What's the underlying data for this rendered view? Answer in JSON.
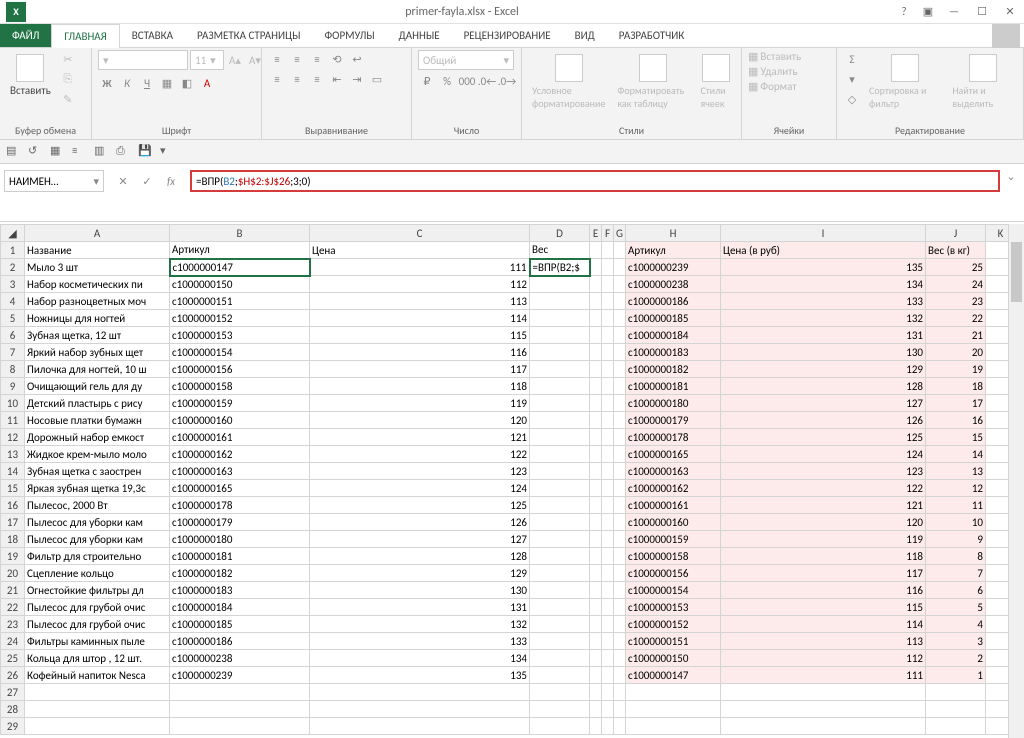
{
  "title": "primer-fayla.xlsx - Excel",
  "tabs": {
    "file": "ФАЙЛ",
    "items": [
      "ГЛАВНАЯ",
      "ВСТАВКА",
      "РАЗМЕТКА СТРАНИЦЫ",
      "ФОРМУЛЫ",
      "ДАННЫЕ",
      "РЕЦЕНЗИРОВАНИЕ",
      "ВИД",
      "РАЗРАБОТЧИК"
    ],
    "active": 0
  },
  "ribbon": {
    "paste": "Вставить",
    "clipboard": "Буфер обмена",
    "font_group": "Шрифт",
    "font_size": "11",
    "align": "Выравнивание",
    "number": "Число",
    "number_format": "Общий",
    "styles": "Стили",
    "cond_fmt": "Условное форматирование",
    "fmt_table": "Форматировать как таблицу",
    "cell_styles": "Стили ячеек",
    "cells": "Ячейки",
    "insert": "Вставить",
    "delete": "Удалить",
    "format": "Формат",
    "editing": "Редактирование",
    "sort": "Сортировка и фильтр",
    "find": "Найти и выделить"
  },
  "namebox": "НАИМЕН…",
  "formula": {
    "raw": "=ВПР(B2;$H$2:$J$26;3;0)",
    "prefix": "=ВПР(",
    "arg1": "B2",
    "sep1": ";",
    "arg2": "$H$2:$J$26",
    "sep2": ";",
    "arg3": "3",
    "sep3": ";",
    "arg4": "0",
    "suffix": ")"
  },
  "columns": [
    "A",
    "B",
    "C",
    "D",
    "E",
    "F",
    "G",
    "H",
    "I",
    "J",
    "K"
  ],
  "headers_left": {
    "A": "Название",
    "B": "Артикул",
    "C": "Цена",
    "D": "Вес"
  },
  "headers_right": {
    "H": "Артикул",
    "I": "Цена (в руб)",
    "J": "Вес (в кг)"
  },
  "d2_display": "=ВПР(B2;$",
  "rows_left": [
    {
      "n": 2,
      "a": "Мыло 3 шт",
      "b": "c1000000147",
      "c": 111
    },
    {
      "n": 3,
      "a": "Набор косметических пи",
      "b": "c1000000150",
      "c": 112
    },
    {
      "n": 4,
      "a": "Набор разноцветных моч",
      "b": "c1000000151",
      "c": 113
    },
    {
      "n": 5,
      "a": "Ножницы для ногтей",
      "b": "c1000000152",
      "c": 114
    },
    {
      "n": 6,
      "a": "Зубная щетка, 12 шт",
      "b": "c1000000153",
      "c": 115
    },
    {
      "n": 7,
      "a": "Яркий набор зубных щет",
      "b": "c1000000154",
      "c": 116
    },
    {
      "n": 8,
      "a": "Пилочка для ногтей, 10 ш",
      "b": "c1000000156",
      "c": 117
    },
    {
      "n": 9,
      "a": "Очищающий гель для ду",
      "b": "c1000000158",
      "c": 118
    },
    {
      "n": 10,
      "a": "Детский пластырь с рису",
      "b": "c1000000159",
      "c": 119
    },
    {
      "n": 11,
      "a": "Носовые платки бумажн",
      "b": "c1000000160",
      "c": 120
    },
    {
      "n": 12,
      "a": "Дорожный набор емкост",
      "b": "c1000000161",
      "c": 121
    },
    {
      "n": 13,
      "a": "Жидкое крем-мыло моло",
      "b": "c1000000162",
      "c": 122
    },
    {
      "n": 14,
      "a": "Зубная щетка с заострен",
      "b": "c1000000163",
      "c": 123
    },
    {
      "n": 15,
      "a": "Яркая зубная щетка 19,3с",
      "b": "c1000000165",
      "c": 124
    },
    {
      "n": 16,
      "a": "Пылесос, 2000 Вт",
      "b": "c1000000178",
      "c": 125
    },
    {
      "n": 17,
      "a": "Пылесос для уборки кам",
      "b": "c1000000179",
      "c": 126
    },
    {
      "n": 18,
      "a": "Пылесос для уборки кам",
      "b": "c1000000180",
      "c": 127
    },
    {
      "n": 19,
      "a": "Фильтр для строительно",
      "b": "c1000000181",
      "c": 128
    },
    {
      "n": 20,
      "a": "Сцепление кольцо",
      "b": "c1000000182",
      "c": 129
    },
    {
      "n": 21,
      "a": "Огнестойкие фильтры дл",
      "b": "c1000000183",
      "c": 130
    },
    {
      "n": 22,
      "a": "Пылесос для грубой очис",
      "b": "c1000000184",
      "c": 131
    },
    {
      "n": 23,
      "a": "Пылесос для грубой очис",
      "b": "c1000000185",
      "c": 132
    },
    {
      "n": 24,
      "a": "Фильтры каминных пыле",
      "b": "c1000000186",
      "c": 133
    },
    {
      "n": 25,
      "a": "Кольца для штор , 12 шт.",
      "b": "c1000000238",
      "c": 134
    },
    {
      "n": 26,
      "a": "Кофейный напиток Nesca",
      "b": "c1000000239",
      "c": 135
    }
  ],
  "rows_right": [
    {
      "h": "c1000000239",
      "i": 135,
      "j": 25
    },
    {
      "h": "c1000000238",
      "i": 134,
      "j": 24
    },
    {
      "h": "c1000000186",
      "i": 133,
      "j": 23
    },
    {
      "h": "c1000000185",
      "i": 132,
      "j": 22
    },
    {
      "h": "c1000000184",
      "i": 131,
      "j": 21
    },
    {
      "h": "c1000000183",
      "i": 130,
      "j": 20
    },
    {
      "h": "c1000000182",
      "i": 129,
      "j": 19
    },
    {
      "h": "c1000000181",
      "i": 128,
      "j": 18
    },
    {
      "h": "c1000000180",
      "i": 127,
      "j": 17
    },
    {
      "h": "c1000000179",
      "i": 126,
      "j": 16
    },
    {
      "h": "c1000000178",
      "i": 125,
      "j": 15
    },
    {
      "h": "c1000000165",
      "i": 124,
      "j": 14
    },
    {
      "h": "c1000000163",
      "i": 123,
      "j": 13
    },
    {
      "h": "c1000000162",
      "i": 122,
      "j": 12
    },
    {
      "h": "c1000000161",
      "i": 121,
      "j": 11
    },
    {
      "h": "c1000000160",
      "i": 120,
      "j": 10
    },
    {
      "h": "c1000000159",
      "i": 119,
      "j": 9
    },
    {
      "h": "c1000000158",
      "i": 118,
      "j": 8
    },
    {
      "h": "c1000000156",
      "i": 117,
      "j": 7
    },
    {
      "h": "c1000000154",
      "i": 116,
      "j": 6
    },
    {
      "h": "c1000000153",
      "i": 115,
      "j": 5
    },
    {
      "h": "c1000000152",
      "i": 114,
      "j": 4
    },
    {
      "h": "c1000000151",
      "i": 113,
      "j": 3
    },
    {
      "h": "c1000000150",
      "i": 112,
      "j": 2
    },
    {
      "h": "c1000000147",
      "i": 111,
      "j": 1
    }
  ],
  "empty_rows": [
    27,
    28,
    29
  ]
}
